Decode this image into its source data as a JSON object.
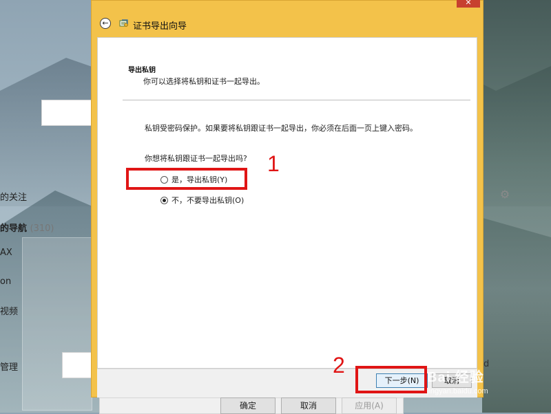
{
  "background_app": {
    "items": [
      {
        "text": "的关注"
      },
      {
        "text": "的导航",
        "count": "(310)"
      },
      {
        "text": "AX"
      },
      {
        "text": "on"
      },
      {
        "text": "视频"
      },
      {
        "text": "管理"
      }
    ],
    "buttons": {
      "ok": "确定",
      "cancel": "取消",
      "apply": "应用(A)"
    },
    "edge_text": "d"
  },
  "wizard": {
    "title": "证书导出向导",
    "section_heading": "导出私钥",
    "section_description": "你可以选择将私钥和证书一起导出。",
    "body_text": "私钥受密码保护。如果要将私钥跟证书一起导出，你必须在后面一页上键入密码。",
    "question": "你想将私钥跟证书一起导出吗?",
    "options": [
      {
        "label": "是，导出私钥(Y)",
        "selected": false
      },
      {
        "label": "不，不要导出私钥(O)",
        "selected": true
      }
    ],
    "buttons": {
      "next": "下一步(N)",
      "cancel": "取消"
    },
    "close_glyph": "✕"
  },
  "annotations": {
    "label_1": "1",
    "label_2": "2"
  },
  "watermark": {
    "main": "Bai 经验",
    "sub": "jingyan.baidu.com"
  },
  "colors": {
    "window_frame": "#f3c24a",
    "annotation_red": "#e01515",
    "close_red": "#c7402f"
  }
}
